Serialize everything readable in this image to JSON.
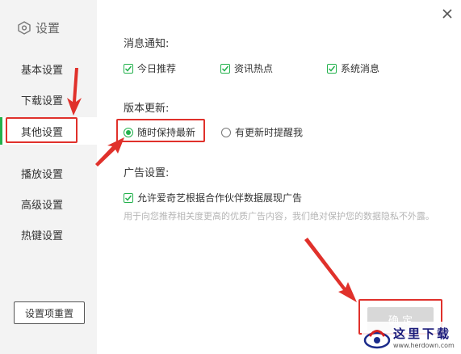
{
  "sidebar": {
    "title": "设置",
    "items": [
      {
        "label": "基本设置"
      },
      {
        "label": "下载设置"
      },
      {
        "label": "其他设置"
      },
      {
        "label": "播放设置"
      },
      {
        "label": "高级设置"
      },
      {
        "label": "热键设置"
      }
    ],
    "active_index": 2,
    "reset_label": "设置项重置"
  },
  "notifications": {
    "title": "消息通知:",
    "options": [
      {
        "label": "今日推荐",
        "checked": true
      },
      {
        "label": "资讯热点",
        "checked": true
      },
      {
        "label": "系统消息",
        "checked": true
      }
    ]
  },
  "version_update": {
    "title": "版本更新:",
    "options": [
      {
        "label": "随时保持最新",
        "selected": true
      },
      {
        "label": "有更新时提醒我",
        "selected": false
      }
    ]
  },
  "ads": {
    "title": "广告设置:",
    "checkbox_label": "允许爱奇艺根据合作伙伴数据展现广告",
    "checked": true,
    "hint": "用于向您推荐相关度更高的优质广告内容，我们绝对保护您的数据隐私不外露。"
  },
  "footer": {
    "confirm_label": "确 定"
  },
  "watermark": {
    "text": "这里下载",
    "url": "www.herdown.com"
  },
  "colors": {
    "accent": "#22b14c",
    "annotation": "#e0312b",
    "sidebar_bg": "#f3f3f3"
  }
}
